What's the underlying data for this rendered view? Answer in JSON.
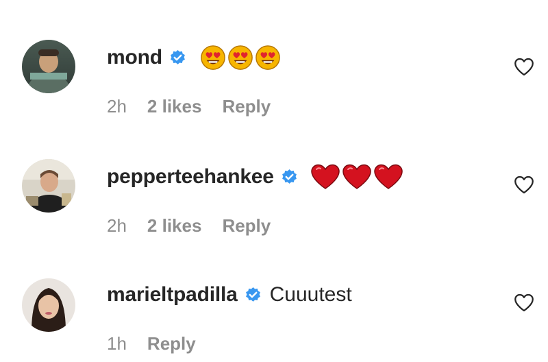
{
  "comments": [
    {
      "username": "mond",
      "verified": true,
      "text": "",
      "emojis": [
        "heart-eyes-face",
        "heart-eyes-face",
        "heart-eyes-face"
      ],
      "time": "2h",
      "likes": "2 likes",
      "reply": "Reply"
    },
    {
      "username": "pepperteehankee",
      "verified": true,
      "text": "",
      "emojis": [
        "red-heart",
        "red-heart",
        "red-heart"
      ],
      "time": "2h",
      "likes": "2 likes",
      "reply": "Reply"
    },
    {
      "username": "marieltpadilla",
      "verified": true,
      "text": "Cuuutest",
      "emojis": [],
      "time": "1h",
      "likes": "",
      "reply": "Reply"
    }
  ],
  "icons": {
    "verified": "verified-badge-icon",
    "like": "heart-outline-icon"
  },
  "colors": {
    "verified_blue": "#3897f0",
    "meta_gray": "#8e8e8e",
    "text": "#262626",
    "heart_red": "#d4121f",
    "emoji_yellow": "#f7b500"
  }
}
